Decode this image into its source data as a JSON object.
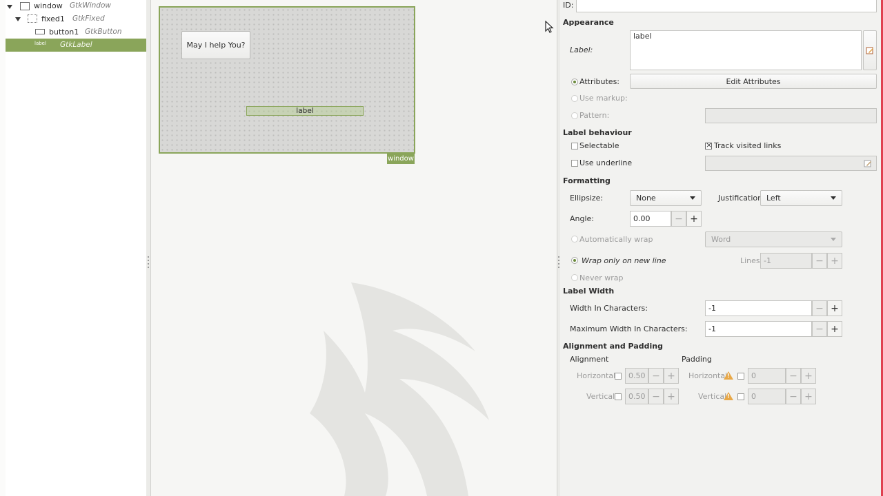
{
  "tree": {
    "rows": [
      {
        "name": "window",
        "type": "GtkWindow"
      },
      {
        "name": "fixed1",
        "type": "GtkFixed"
      },
      {
        "name": "button1",
        "type": "GtkButton"
      },
      {
        "name": "label",
        "type": "GtkLabel"
      }
    ]
  },
  "canvas": {
    "button_label": "May I help You?",
    "label_text": "label",
    "window_tag": "window"
  },
  "props": {
    "id_label": "ID:",
    "id_value": "",
    "appearance": "Appearance",
    "label_label": "Label:",
    "label_value": "label",
    "attributes_label": "Attributes:",
    "edit_attributes": "Edit Attributes",
    "use_markup": "Use markup:",
    "pattern": "Pattern:",
    "label_behaviour": "Label behaviour",
    "selectable": "Selectable",
    "track_visited": "Track visited links",
    "use_underline": "Use underline",
    "formatting": "Formatting",
    "ellipsize_label": "Ellipsize:",
    "ellipsize_value": "None",
    "justification_label": "Justification:",
    "justification_value": "Left",
    "angle_label": "Angle:",
    "angle_value": "0.00",
    "auto_wrap": "Automatically wrap",
    "wrap_mode": "Word",
    "wrap_newline": "Wrap only on new line",
    "lines_label": "Lines",
    "lines_value": "-1",
    "never_wrap": "Never wrap",
    "label_width": "Label Width",
    "width_chars_label": "Width In Characters:",
    "width_chars_value": "-1",
    "max_width_label": "Maximum Width In Characters:",
    "max_width_value": "-1",
    "align_padding": "Alignment and Padding",
    "alignment": "Alignment",
    "padding": "Padding",
    "horizontal": "Horizontal",
    "vertical": "Vertical",
    "h_align_value": "0.50",
    "v_align_value": "0.50",
    "h_pad_value": "0",
    "v_pad_value": "0",
    "minus": "−",
    "plus": "+"
  },
  "colors": {
    "selection": "#8aa55a",
    "warning": "#e8a848"
  }
}
